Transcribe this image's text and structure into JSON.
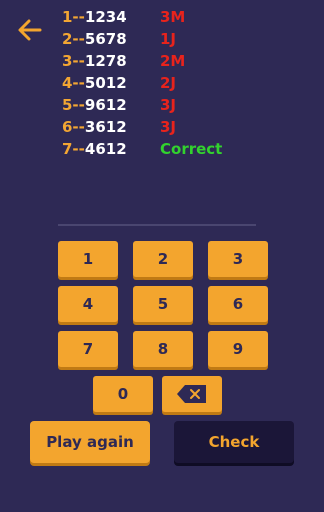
{
  "history": [
    {
      "index": "1--",
      "code": "1234",
      "result": "3M",
      "correct": false
    },
    {
      "index": "2--",
      "code": "5678",
      "result": "1J",
      "correct": false
    },
    {
      "index": "3--",
      "code": "1278",
      "result": "2M",
      "correct": false
    },
    {
      "index": "4--",
      "code": "5012",
      "result": "2J",
      "correct": false
    },
    {
      "index": "5--",
      "code": "9612",
      "result": "3J",
      "correct": false
    },
    {
      "index": "6--",
      "code": "3612",
      "result": "3J",
      "correct": false
    },
    {
      "index": "7--",
      "code": "4612",
      "result": "Correct",
      "correct": true
    }
  ],
  "keypad": {
    "keys": [
      "1",
      "2",
      "3",
      "4",
      "5",
      "6",
      "7",
      "8",
      "9",
      "0"
    ],
    "backspace_icon": "backspace-icon"
  },
  "actions": {
    "play_again_label": "Play again",
    "check_label": "Check"
  },
  "icons": {
    "back": "arrow-left-icon"
  },
  "colors": {
    "background": "#2e2955",
    "accent_orange": "#f3a52e",
    "result_red": "#e8231c",
    "result_green": "#32d22e",
    "text_white": "#ffffff",
    "check_button_bg": "#1b1638"
  }
}
